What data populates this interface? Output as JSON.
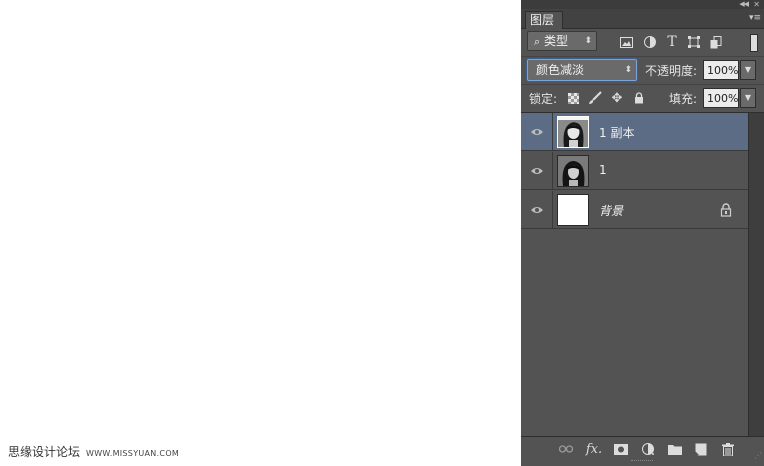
{
  "canvas": {
    "watermark_cn": "思缘设计论坛",
    "watermark_url": "WWW.MISSYUAN.COM"
  },
  "panel": {
    "tab_label": "图层",
    "filter": {
      "kind_label": "类型",
      "icons": [
        "image-filter-icon",
        "adjustment-filter-icon",
        "type-filter-icon",
        "shape-filter-icon",
        "smart-object-filter-icon"
      ]
    },
    "blend_mode": "颜色减淡",
    "opacity_label": "不透明度:",
    "opacity_value": "100%",
    "lock_label": "锁定:",
    "fill_label": "填充:",
    "fill_value": "100%",
    "layers": [
      {
        "name": "1 副本",
        "selected": true,
        "visible": true,
        "thumb": "photo"
      },
      {
        "name": "1",
        "selected": false,
        "visible": true,
        "thumb": "photo"
      },
      {
        "name": "背景",
        "selected": false,
        "visible": true,
        "thumb": "white",
        "locked": true
      }
    ],
    "bottom_icons": [
      "link-layers-icon",
      "fx-icon",
      "add-mask-icon",
      "adjustment-layer-icon",
      "new-group-icon",
      "new-layer-icon",
      "trash-icon"
    ],
    "colors": {
      "panel_bg": "#535353",
      "selected_row": "#5c6c85",
      "tab_bg": "#424242",
      "blend_focus": "#7aa3d9"
    }
  }
}
